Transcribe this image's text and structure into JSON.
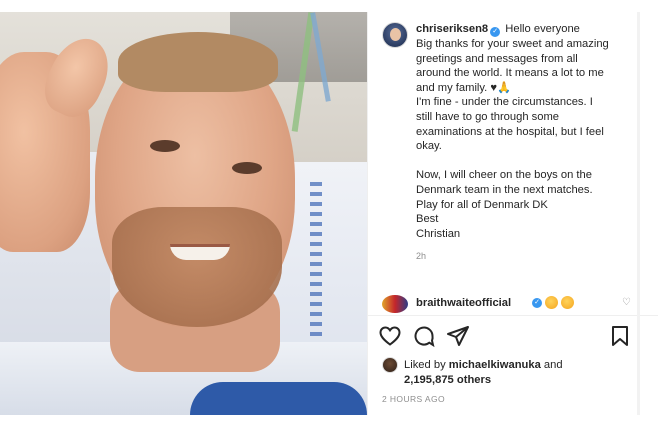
{
  "post": {
    "username": "chriseriksen8",
    "caption_lines": [
      "Hello everyone",
      "Big thanks for your sweet and amazing",
      "greetings and messages from all",
      "around the world. It means a lot to me",
      "and my family. ♥🙏",
      "I'm fine - under the circumstances. I",
      "still have to go through some",
      "examinations at the hospital, but I feel",
      "okay.",
      "",
      "Now, I will cheer on the boys on the",
      "Denmark team in the next matches.",
      "Play for all of Denmark DK",
      "Best",
      "Christian"
    ],
    "time_ago": "2h"
  },
  "comment": {
    "username": "braithwaiteofficial"
  },
  "likes": {
    "prefix": "Liked by ",
    "user": "michaelkiwanuka",
    "middle": " and",
    "count": "2,195,875 others"
  },
  "posted_ago": "2 HOURS AGO",
  "icons": {
    "like": "heart-icon",
    "comment": "comment-icon",
    "share": "share-icon",
    "save": "bookmark-icon",
    "verified": "verified-badge-icon"
  },
  "colors": {
    "verified": "#3897f0",
    "text": "#262626",
    "muted": "#8e8e8e"
  }
}
